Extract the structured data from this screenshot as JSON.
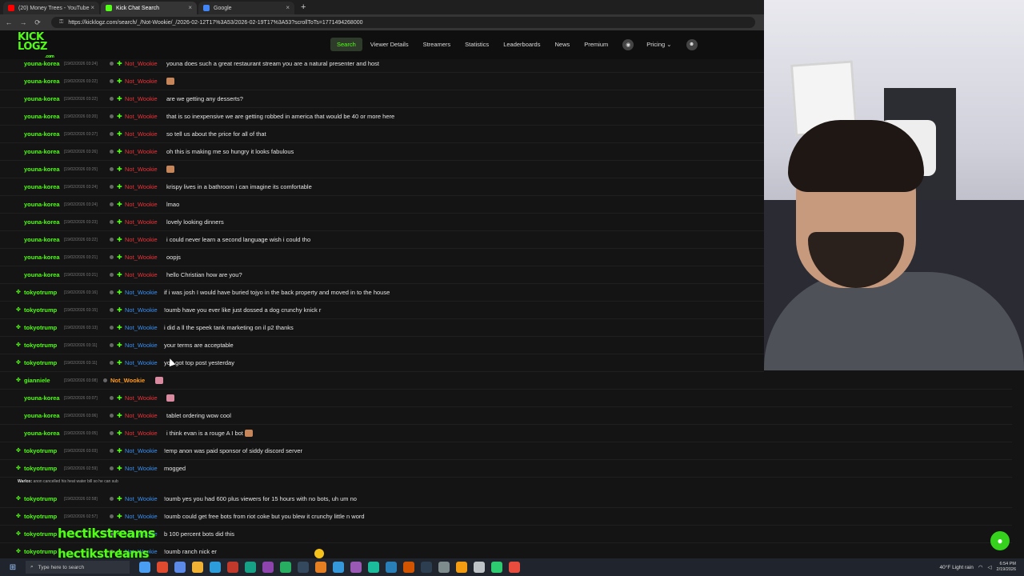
{
  "browser": {
    "tabs": [
      {
        "title": "(20) Money Trees - YouTube",
        "color": "#ff0000"
      },
      {
        "title": "Kick Chat Search",
        "color": "#53fc18"
      },
      {
        "title": "Google",
        "color": "#4285f4"
      }
    ],
    "new_tab": "+",
    "url": "https://kicklogz.com/search/_/Not-Wookie/_/2026-02-12T17%3A53/2026-02-19T17%3A53?scrollToTs=1771494268000"
  },
  "site": {
    "logo_top": "KICK",
    "logo_bottom": "LOGZ",
    "logo_sub": ".com",
    "nav": [
      "Search",
      "Viewer Details",
      "Streamers",
      "Statistics",
      "Leaderboards",
      "News",
      "Premium",
      "Pricing ⌄"
    ]
  },
  "rows": [
    {
      "user": "youna-korea",
      "ts": "[19/02/2026 03:24]",
      "target": "Not_Wookie",
      "tclass": "red",
      "msg": "youna does such a great restaurant stream you are a natural presenter and host"
    },
    {
      "user": "youna-korea",
      "ts": "[19/02/2026 03:22]",
      "target": "Not_Wookie",
      "tclass": "red",
      "msg": "",
      "emote": "tan"
    },
    {
      "user": "youna-korea",
      "ts": "[19/02/2026 03:22]",
      "target": "Not_Wookie",
      "tclass": "red",
      "msg": "are we getting any desserts?"
    },
    {
      "user": "youna-korea",
      "ts": "[19/02/2026 03:20]",
      "target": "Not_Wookie",
      "tclass": "red",
      "msg": "that is so inexpensive we are getting robbed in america that would be 40 or more here"
    },
    {
      "user": "youna-korea",
      "ts": "[19/02/2026 03:27]",
      "target": "Not_Wookie",
      "tclass": "red",
      "msg": "so tell us about the price for all of that"
    },
    {
      "user": "youna-korea",
      "ts": "[19/02/2026 03:26]",
      "target": "Not_Wookie",
      "tclass": "red",
      "msg": "oh this is making me so hungry it looks fabulous"
    },
    {
      "user": "youna-korea",
      "ts": "[19/02/2026 03:25]",
      "target": "Not_Wookie",
      "tclass": "red",
      "msg": "",
      "emote": "tan"
    },
    {
      "user": "youna-korea",
      "ts": "[19/02/2026 03:24]",
      "target": "Not_Wookie",
      "tclass": "red",
      "msg": "krispy lives in a bathroom i can imagine its comfortable"
    },
    {
      "user": "youna-korea",
      "ts": "[19/02/2026 03:24]",
      "target": "Not_Wookie",
      "tclass": "red",
      "msg": "lmao"
    },
    {
      "user": "youna-korea",
      "ts": "[19/02/2026 03:23]",
      "target": "Not_Wookie",
      "tclass": "red",
      "msg": "lovely looking dinners"
    },
    {
      "user": "youna-korea",
      "ts": "[19/02/2026 03:22]",
      "target": "Not_Wookie",
      "tclass": "red",
      "msg": "i could never learn a second language wish i could tho"
    },
    {
      "user": "youna-korea",
      "ts": "[19/02/2026 03:21]",
      "target": "Not_Wookie",
      "tclass": "red",
      "msg": "oopjs"
    },
    {
      "user": "youna-korea",
      "ts": "[19/02/2026 03:21]",
      "target": "Not_Wookie",
      "tclass": "red",
      "msg": "hello Christian how are you?"
    },
    {
      "user": "tokyotrump",
      "ts": "[19/02/2026 03:16]",
      "target": "Not_Wookie",
      "tclass": "blue",
      "msg": "if i was josh I would have buried tojyo in the back property and moved in to the house",
      "icon": true
    },
    {
      "user": "tokyotrump",
      "ts": "[19/02/2026 03:15]",
      "target": "Not_Wookie",
      "tclass": "blue",
      "msg": "!oumb have you ever like just dossed a dog crunchy knick r",
      "icon": true
    },
    {
      "user": "tokyotrump",
      "ts": "[19/02/2026 03:13]",
      "target": "Not_Wookie",
      "tclass": "blue",
      "msg": "i did a ll the speek tank marketing on il p2 thanks",
      "icon": true
    },
    {
      "user": "tokyotrump",
      "ts": "[19/02/2026 03:11]",
      "target": "Not_Wookie",
      "tclass": "blue",
      "msg": "your terms are acceptable",
      "icon": true
    },
    {
      "user": "tokyotrump",
      "ts": "[19/02/2026 03:11]",
      "target": "Not_Wookie",
      "tclass": "blue",
      "msg": "you got top post yesterday",
      "icon": true
    },
    {
      "user": "gianniele",
      "ts": "[19/02/2026 03:08]",
      "target": "Not_Wookie",
      "tclass": "orange",
      "msg": "",
      "emote": "pink",
      "icon": true,
      "noplus": true
    },
    {
      "user": "youna-korea",
      "ts": "[19/02/2026 03:07]",
      "target": "Not_Wookie",
      "tclass": "red",
      "msg": "",
      "emote": "pink"
    },
    {
      "user": "youna-korea",
      "ts": "[19/02/2026 03:06]",
      "target": "Not_Wookie",
      "tclass": "red",
      "msg": "tablet ordering wow cool"
    },
    {
      "user": "youna-korea",
      "ts": "[19/02/2026 03:05]",
      "target": "Not_Wookie",
      "tclass": "red",
      "msg": "i think evan is a rouge A I bot",
      "emote_after": "tan"
    },
    {
      "user": "tokyotrump",
      "ts": "[19/02/2026 03:03]",
      "target": "Not_Wookie",
      "tclass": "blue",
      "msg": "!emp anon was paid sponsor of siddy discord server",
      "icon": true
    },
    {
      "user": "tokyotrump",
      "ts": "[19/02/2026 02:59]",
      "target": "Not_Wookie",
      "tclass": "blue",
      "msg": "mogged",
      "icon": true
    },
    {
      "user": "tokyotrump",
      "ts": "[19/02/2026 02:58]",
      "target": "Not_Wookie",
      "tclass": "blue",
      "msg": "!oumb yes you had 600 plus viewers for 15 hours with no bots, uh um no",
      "icon": true
    },
    {
      "user": "tokyotrump",
      "ts": "[19/02/2026 02:57]",
      "target": "Not_Wookie",
      "tclass": "blue",
      "msg": "!oumb could get free bots from riot coke but you blew it crunchy little n word",
      "icon": true
    },
    {
      "user": "tokyotrump",
      "ts": "",
      "target": "Not_Wookie",
      "tclass": "blue",
      "msg": "b 100 percent bots did this",
      "icon": true
    },
    {
      "user": "tokyotrump",
      "ts": "",
      "target": "Not_Wookie",
      "tclass": "blue",
      "msg": "!oumb ranch nick er",
      "icon": true
    }
  ],
  "warlox_note": {
    "name": "Warlox:",
    "text": "anon cancelled his heat water bill so he can sub"
  },
  "overlay": {
    "hectik1": "hectikstreams",
    "hectik2": "hectikstreams"
  },
  "taskbar": {
    "search_placeholder": "Type here to search",
    "weather": "40°F  Light rain",
    "time": "6:54 PM",
    "date": "2/19/2026"
  },
  "colors": {
    "kick_green": "#53fc18",
    "target_red": "#e8343a",
    "target_blue": "#3b8ff0",
    "target_orange": "#ff9a1f"
  }
}
